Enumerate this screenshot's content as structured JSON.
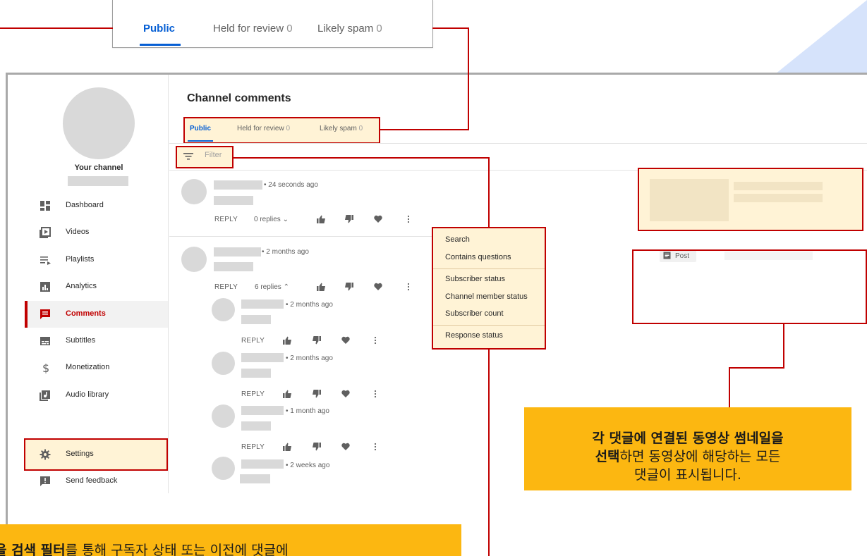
{
  "zoomed_tabs": {
    "public": "Public",
    "held_for_review": "Held for review",
    "held_count": "0",
    "likely_spam": "Likely spam",
    "spam_count": "0"
  },
  "sidebar": {
    "channel_label": "Your channel",
    "items": [
      {
        "label": "Dashboard",
        "icon": "dashboard-icon"
      },
      {
        "label": "Videos",
        "icon": "videos-icon"
      },
      {
        "label": "Playlists",
        "icon": "playlists-icon"
      },
      {
        "label": "Analytics",
        "icon": "analytics-icon"
      },
      {
        "label": "Comments",
        "icon": "comments-icon",
        "active": true
      },
      {
        "label": "Subtitles",
        "icon": "subtitles-icon"
      },
      {
        "label": "Monetization",
        "icon": "monetization-icon"
      },
      {
        "label": "Audio library",
        "icon": "audio-library-icon"
      },
      {
        "label": "Settings",
        "icon": "gear-icon"
      },
      {
        "label": "Send feedback",
        "icon": "feedback-icon"
      }
    ]
  },
  "main": {
    "title": "Channel comments",
    "tabs": {
      "public": "Public",
      "held_for_review": "Held for review",
      "held_count": "0",
      "likely_spam": "Likely spam",
      "spam_count": "0"
    },
    "filter_placeholder": "Filter",
    "reply_label": "REPLY",
    "comments": [
      {
        "time": "• 24 seconds ago",
        "replies": "0 replies",
        "chevron": "chevron-down"
      },
      {
        "time": "• 2 months ago",
        "replies": "6 replies",
        "chevron": "chevron-up"
      }
    ],
    "replies": [
      {
        "time": "• 2 months ago"
      },
      {
        "time": "• 2 months ago"
      },
      {
        "time": "• 1 month ago"
      },
      {
        "time": "• 2 weeks ago"
      }
    ]
  },
  "filter_menu": {
    "items": [
      "Search",
      "Contains questions",
      "Subscriber status",
      "Channel member status",
      "Subscriber count",
      "Response status"
    ]
  },
  "right_panel": {
    "post_label": "Post"
  },
  "callouts": {
    "right_line1_bold": "각 댓글에 연결된 동영상 썸네일을",
    "right_line2_bold": "선택",
    "right_line2_rest": "하면 동영상에 해당하는 모든",
    "right_line3": "댓글이 표시됩니다.",
    "left_bold": "을 검색 필터",
    "left_rest": "를 통해 구독자 상태 또는 이전에 댓글에"
  },
  "colors": {
    "accent_blue": "#065fd4",
    "highlight_red": "#c00000",
    "highlight_fill": "#fff3d6",
    "callout_yellow": "#fcb711"
  }
}
